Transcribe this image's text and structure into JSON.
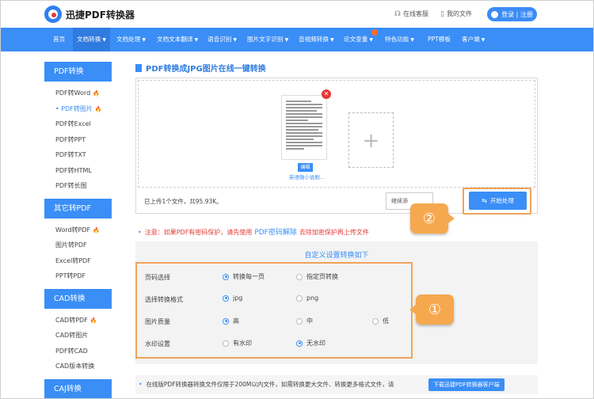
{
  "header": {
    "logo_text": "迅捷PDF转换器",
    "links": [
      {
        "icon": "headset-icon",
        "label": "在线客服"
      },
      {
        "icon": "file-icon",
        "label": "我的文件"
      }
    ],
    "login_label": "登录 | 注册"
  },
  "nav": {
    "items": [
      {
        "label": "首页",
        "dropdown": false
      },
      {
        "label": "文档转换",
        "dropdown": true,
        "active": true
      },
      {
        "label": "文档处理",
        "dropdown": true
      },
      {
        "label": "文档文本翻译",
        "dropdown": true
      },
      {
        "label": "语音识别",
        "dropdown": true
      },
      {
        "label": "图片文字识别",
        "dropdown": true
      },
      {
        "label": "音视频转换",
        "dropdown": true
      },
      {
        "label": "论文查重",
        "dropdown": true
      },
      {
        "label": "特色功能",
        "dropdown": true
      },
      {
        "label": "PPT模板",
        "dropdown": false
      },
      {
        "label": "客户端",
        "dropdown": true
      }
    ],
    "badge": "new"
  },
  "sidebar": {
    "sections": [
      {
        "title": "PDF转换",
        "items": [
          {
            "label": "PDF转Word",
            "hot": true
          },
          {
            "label": "PDF转图片",
            "hot": true,
            "active": true
          },
          {
            "label": "PDF转Excel"
          },
          {
            "label": "PDF转PPT"
          },
          {
            "label": "PDF转TXT"
          },
          {
            "label": "PDF转HTML"
          },
          {
            "label": "PDF转长图"
          }
        ]
      },
      {
        "title": "其它转PDF",
        "items": [
          {
            "label": "Word转PDF",
            "hot": true
          },
          {
            "label": "图片转PDF"
          },
          {
            "label": "Excel转PDF"
          },
          {
            "label": "PPT转PDF"
          }
        ]
      },
      {
        "title": "CAD转换",
        "items": [
          {
            "label": "CAD转PDF",
            "hot": true
          },
          {
            "label": "CAD转图片"
          },
          {
            "label": "PDF转CAD"
          },
          {
            "label": "CAD版本转换"
          }
        ]
      },
      {
        "title": "CAJ转换",
        "items": []
      }
    ]
  },
  "main": {
    "title": "PDF转换成JPG图片在线一键转换",
    "upload": {
      "file_edit_label": "编辑",
      "file_name": "英语微小说剧...",
      "add_icon": "plus-icon",
      "summary": "已上传1个文件，共95.93K。",
      "continue_label": "继续添",
      "start_label": "开始处理"
    },
    "callouts": {
      "one": "①",
      "two": "②"
    },
    "notice": {
      "prefix": "注意：如果PDF有密码保护，请先使用",
      "link": "PDF密码解除",
      "suffix": "去除加密保护再上传文件"
    },
    "settings": {
      "title": "自定义设置转换如下",
      "rows": [
        {
          "label": "页码选择",
          "options": [
            {
              "label": "转换每一页",
              "selected": true
            },
            {
              "label": "指定页转换",
              "selected": false
            }
          ]
        },
        {
          "label": "选择转换格式",
          "options": [
            {
              "label": "jpg",
              "selected": true
            },
            {
              "label": "png",
              "selected": false
            }
          ]
        },
        {
          "label": "图片质量",
          "options": [
            {
              "label": "高",
              "selected": true
            },
            {
              "label": "中",
              "selected": false
            },
            {
              "label": "低",
              "selected": false
            }
          ]
        },
        {
          "label": "水印设置",
          "options": [
            {
              "label": "有水印",
              "selected": false
            },
            {
              "label": "无水印",
              "selected": true
            }
          ]
        }
      ]
    },
    "bottom_note": {
      "text": "在线版PDF转换器转换文件仅限于200M以内文件，如需转换更大文件、转换更多格式文件，请",
      "button": "下载迅捷PDF转换器客户端"
    }
  }
}
